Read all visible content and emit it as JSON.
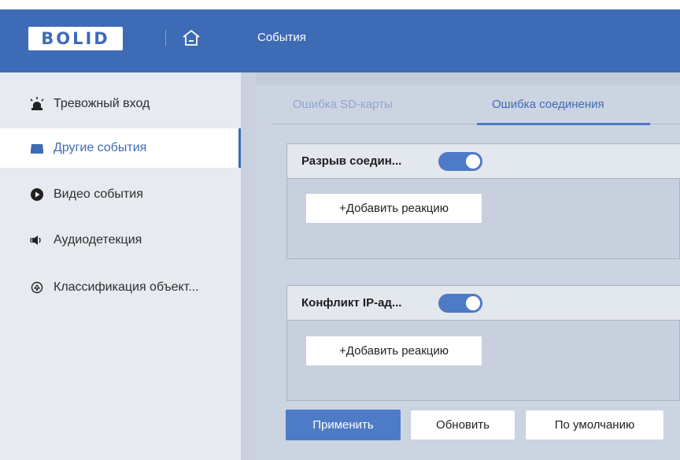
{
  "header": {
    "logo_text": "BOLID",
    "home_icon": "home-icon",
    "title": "События"
  },
  "sidebar": {
    "items": [
      {
        "label": "Тревожный вход",
        "icon": "alarm-siren-icon",
        "active": false
      },
      {
        "label": "Другие события",
        "icon": "drive-icon",
        "active": true
      },
      {
        "label": "Видео события",
        "icon": "video-play-icon",
        "active": false
      },
      {
        "label": "Аудиодетекция",
        "icon": "speaker-icon",
        "active": false
      },
      {
        "label": "Классификация объект...",
        "icon": "classification-icon",
        "active": false
      }
    ]
  },
  "tabs": [
    {
      "label": "Ошибка SD-карты",
      "active": false
    },
    {
      "label": "Ошибка соединения",
      "active": true
    }
  ],
  "cards": [
    {
      "title": "Разрыв соедин...",
      "enabled": true,
      "add_label": "+Добавить реакцию"
    },
    {
      "title": "Конфликт IP-ад...",
      "enabled": true,
      "add_label": "+Добавить реакцию"
    }
  ],
  "footer": {
    "apply_label": "Применить",
    "refresh_label": "Обновить",
    "default_label": "По умолчанию"
  },
  "colors": {
    "accent": "#3d6bb5",
    "toggle_on": "#4d7bc6",
    "inactive_tab": "#8ea5cf"
  }
}
